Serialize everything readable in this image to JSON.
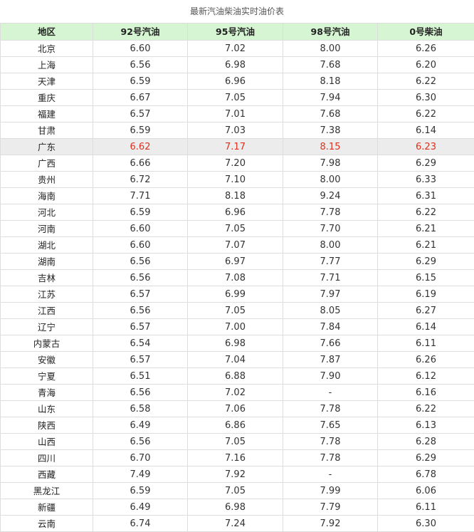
{
  "title": "最新汽油柴油实时油价表",
  "columns": [
    "地区",
    "92号汽油",
    "95号汽油",
    "98号汽油",
    "0号柴油"
  ],
  "highlight_color": "#e0301e",
  "highlight_row": 6,
  "rows": [
    [
      "北京",
      "6.60",
      "7.02",
      "8.00",
      "6.26"
    ],
    [
      "上海",
      "6.56",
      "6.98",
      "7.68",
      "6.20"
    ],
    [
      "天津",
      "6.59",
      "6.96",
      "8.18",
      "6.22"
    ],
    [
      "重庆",
      "6.67",
      "7.05",
      "7.94",
      "6.30"
    ],
    [
      "福建",
      "6.57",
      "7.01",
      "7.68",
      "6.22"
    ],
    [
      "甘肃",
      "6.59",
      "7.03",
      "7.38",
      "6.14"
    ],
    [
      "广东",
      "6.62",
      "7.17",
      "8.15",
      "6.23"
    ],
    [
      "广西",
      "6.66",
      "7.20",
      "7.98",
      "6.29"
    ],
    [
      "贵州",
      "6.72",
      "7.10",
      "8.00",
      "6.33"
    ],
    [
      "海南",
      "7.71",
      "8.18",
      "9.24",
      "6.31"
    ],
    [
      "河北",
      "6.59",
      "6.96",
      "7.78",
      "6.22"
    ],
    [
      "河南",
      "6.60",
      "7.05",
      "7.70",
      "6.21"
    ],
    [
      "湖北",
      "6.60",
      "7.07",
      "8.00",
      "6.21"
    ],
    [
      "湖南",
      "6.56",
      "6.97",
      "7.77",
      "6.29"
    ],
    [
      "吉林",
      "6.56",
      "7.08",
      "7.71",
      "6.15"
    ],
    [
      "江苏",
      "6.57",
      "6.99",
      "7.97",
      "6.19"
    ],
    [
      "江西",
      "6.56",
      "7.05",
      "8.05",
      "6.27"
    ],
    [
      "辽宁",
      "6.57",
      "7.00",
      "7.84",
      "6.14"
    ],
    [
      "内蒙古",
      "6.54",
      "6.98",
      "7.66",
      "6.11"
    ],
    [
      "安徽",
      "6.57",
      "7.04",
      "7.87",
      "6.26"
    ],
    [
      "宁夏",
      "6.51",
      "6.88",
      "7.90",
      "6.12"
    ],
    [
      "青海",
      "6.56",
      "7.02",
      "-",
      "6.16"
    ],
    [
      "山东",
      "6.58",
      "7.06",
      "7.78",
      "6.22"
    ],
    [
      "陕西",
      "6.49",
      "6.86",
      "7.65",
      "6.13"
    ],
    [
      "山西",
      "6.56",
      "7.05",
      "7.78",
      "6.28"
    ],
    [
      "四川",
      "6.70",
      "7.16",
      "7.78",
      "6.29"
    ],
    [
      "西藏",
      "7.49",
      "7.92",
      "-",
      "6.78"
    ],
    [
      "黑龙江",
      "6.59",
      "7.05",
      "7.99",
      "6.06"
    ],
    [
      "新疆",
      "6.49",
      "6.98",
      "7.79",
      "6.11"
    ],
    [
      "云南",
      "6.74",
      "7.24",
      "7.92",
      "6.30"
    ]
  ]
}
